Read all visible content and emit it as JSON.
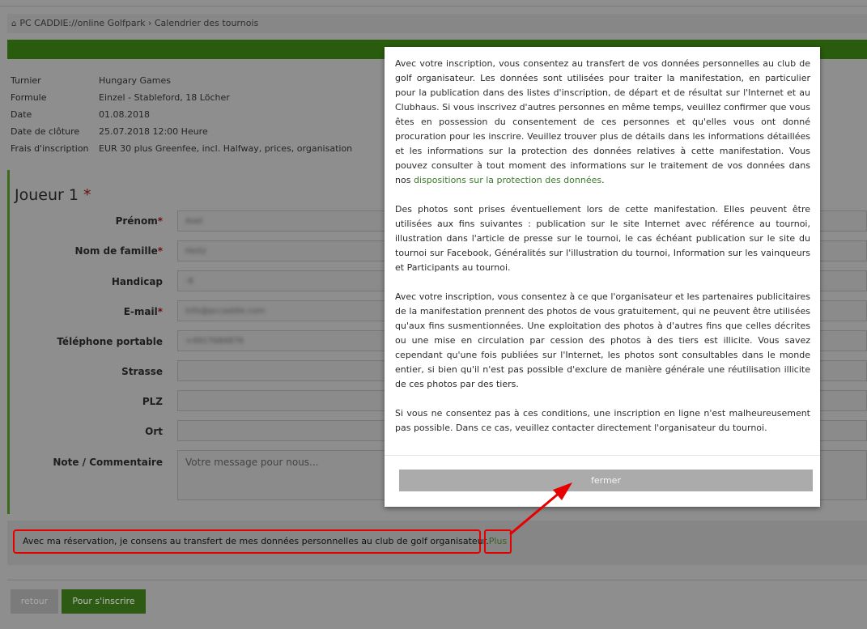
{
  "breadcrumb": {
    "text": "PC CADDIE://online Golfpark › Calendrier des tournois"
  },
  "info": [
    {
      "key": "Turnier",
      "value": "Hungary Games"
    },
    {
      "key": "Formule",
      "value": "Einzel - Stableford, 18 Löcher"
    },
    {
      "key": "Date",
      "value": "01.08.2018"
    },
    {
      "key": "Date de clôture",
      "value": "25.07.2018 12:00 Heure"
    },
    {
      "key": "Frais d'inscription",
      "value": "EUR 30 plus Greenfee, incl. Halfway, prices, organisation"
    }
  ],
  "form": {
    "player_title": "Joueur 1",
    "required_mark": "*",
    "fields": {
      "prenom": {
        "label": "Prénom",
        "value": "Axel"
      },
      "nom": {
        "label": "Nom de famille",
        "value": "Heitz"
      },
      "handicap": {
        "label": "Handicap",
        "value": "-8"
      },
      "email": {
        "label": "E-mail",
        "value": "info@pccaddie.com"
      },
      "telephone": {
        "label": "Téléphone portable",
        "value": "+4917684876"
      },
      "strasse": {
        "label": "Strasse",
        "value": ""
      },
      "plz": {
        "label": "PLZ",
        "value": ""
      },
      "ort": {
        "label": "Ort",
        "value": ""
      },
      "note": {
        "label": "Note / Commentaire",
        "placeholder": "Votre message pour nous..."
      }
    }
  },
  "consent": {
    "text": "Avec ma réservation, je consens au transfert de mes données personnelles au club de golf organisateur.",
    "more": "Plus"
  },
  "buttons": {
    "back": "retour",
    "register": "Pour s'inscrire"
  },
  "modal": {
    "p1": "Avec votre inscription, vous consentez au transfert de vos données personnelles au club de golf organisateur. Les données sont utilisées pour traiter la manifestation, en particulier pour la publication dans des listes d'inscription, de départ et de résultat sur l'Internet et au Clubhaus. Si vous inscrivez d'autres personnes en même temps, veuillez confirmer que vous êtes en possession du consentement de ces personnes et qu'elles vous ont donné procuration pour les inscrire. Veuillez trouver plus de détails dans les informations détaillées et les informations sur la protection des données relatives à cette manifestation. Vous pouvez consulter à tout moment des informations sur le traitement de vos données dans nos",
    "p1_link": "dispositions sur la protection des données",
    "p1_end": ".",
    "p2": "Des photos sont prises éventuellement lors de cette manifestation. Elles peuvent être utilisées aux fins suivantes : publication sur le site Internet avec référence au tournoi, illustration dans l'article de presse sur le tournoi, le cas échéant publication sur le site du tournoi sur Facebook, Généralités sur l'illustration du tournoi, Information sur les vainqueurs et Participants au tournoi.",
    "p3": "Avec votre inscription, vous consentez à ce que l'organisateur et les partenaires publicitaires de la manifestation prennent des photos de vous gratuitement, qui ne peuvent être utilisées qu'aux fins susmentionnées. Une exploitation des photos à d'autres fins que celles décrites ou une mise en circulation par cession des photos à des tiers est illicite. Vous savez cependant qu'une fois publiées sur l'Internet, les photos sont consultables dans le monde entier, si bien qu'il n'est pas possible d'exclure de manière générale une réutilisation illicite de ces photos par des tiers.",
    "p4": "Si vous ne consentez pas à ces conditions, une inscription en ligne n'est malheureusement pas possible. Dans ce cas, veuillez contacter directement l'organisateur du tournoi.",
    "close": "fermer"
  },
  "colors": {
    "accent_green": "#5cb85c",
    "highlight_red": "#e60000"
  }
}
